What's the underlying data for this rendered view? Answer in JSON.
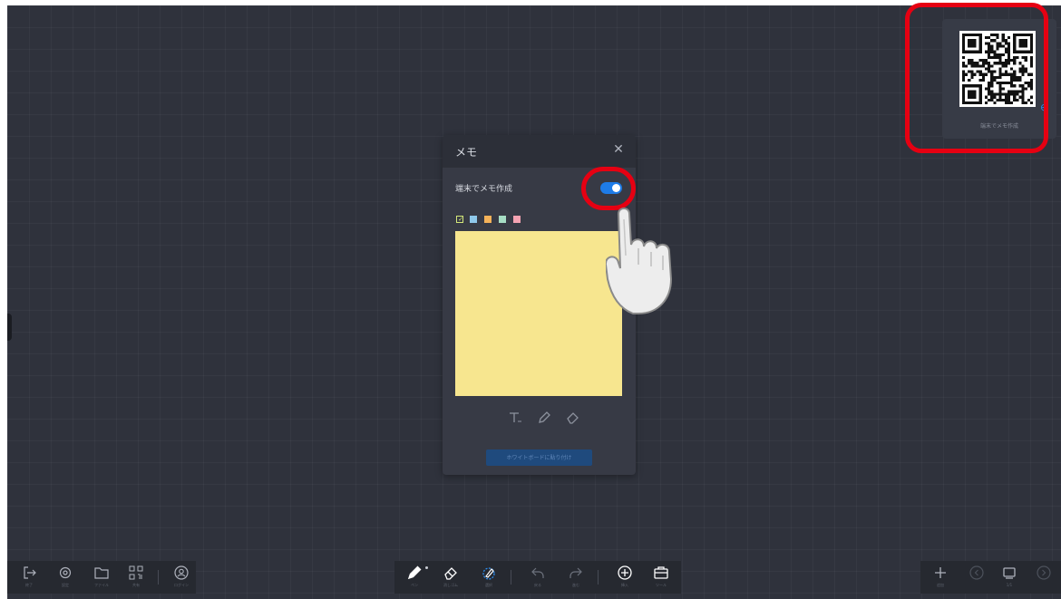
{
  "memo": {
    "title": "メモ",
    "toggle_label": "端末でメモ作成",
    "toggle_on": true,
    "colors": [
      "#d4e87a",
      "#8ec8ea",
      "#f4b259",
      "#a6ddc4",
      "#f5a3b2"
    ],
    "selected_color": "#d4e87a",
    "note_color": "#f7e68f",
    "tools": [
      "text-icon",
      "pen-icon",
      "eraser-icon"
    ],
    "paste_button": "ホワイトボードに貼り付け"
  },
  "qr_panel": {
    "caption": "端末でメモ作成"
  },
  "toolbar": {
    "left": [
      {
        "icon": "exit-icon",
        "label": "終了"
      },
      {
        "icon": "settings-icon",
        "label": "設定"
      },
      {
        "icon": "folder-icon",
        "label": "ファイル"
      },
      {
        "icon": "qr-icon",
        "label": "共有"
      },
      {
        "icon": "account-icon",
        "label": "ログイン"
      }
    ],
    "center": [
      {
        "icon": "pen-icon",
        "label": "ペン"
      },
      {
        "icon": "eraser-icon",
        "label": "消しゴム"
      },
      {
        "icon": "select-icon",
        "label": "選択"
      },
      {
        "icon": "undo-icon",
        "label": "戻る"
      },
      {
        "icon": "redo-icon",
        "label": "進む"
      },
      {
        "icon": "insert-icon",
        "label": "挿入"
      },
      {
        "icon": "tools-icon",
        "label": "ツール"
      }
    ],
    "right": [
      {
        "icon": "add-page-icon",
        "label": "追加"
      },
      {
        "icon": "prev-page-icon",
        "label": ""
      },
      {
        "icon": "pages-icon",
        "label": "1/1"
      },
      {
        "icon": "next-page-icon",
        "label": ""
      }
    ]
  },
  "colors": {
    "board": "#2f323c",
    "accent": "#1e7ce8",
    "highlight": "#e60012"
  }
}
